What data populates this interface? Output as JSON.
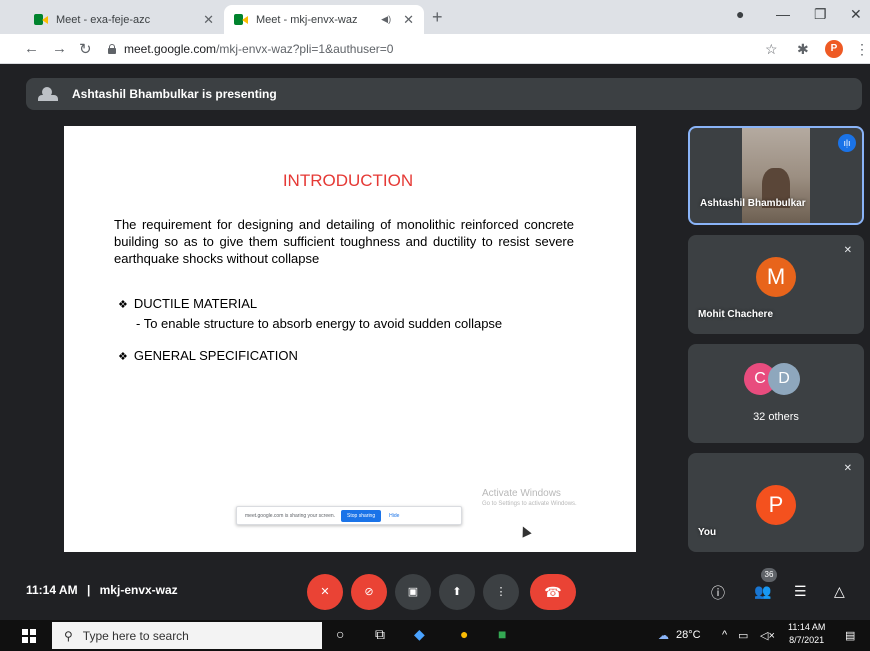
{
  "browser": {
    "tabs": [
      {
        "title": "Meet - exa-feje-azc",
        "active": false
      },
      {
        "title": "Meet - mkj-envx-waz",
        "active": true
      }
    ],
    "url_host": "meet.google.com",
    "url_rest": "/mkj-envx-waz?pli=1&authuser=0",
    "profile_initial": "P"
  },
  "meet": {
    "presenting_text": "Ashtashil Bhambulkar is presenting",
    "slide": {
      "title": "INTRODUCTION",
      "body": "The requirement for designing and detailing of monolithic reinforced concrete building so as to give them sufficient toughness and ductility to resist severe earthquake shocks without collapse",
      "bullet1": "DUCTILE MATERIAL",
      "bullet1_sub": "- To enable structure to absorb energy to avoid sudden collapse",
      "bullet2": "GENERAL SPECIFICATION",
      "share_notice": "meet.google.com is sharing your screen.",
      "stop_sharing": "Stop sharing",
      "hide": "Hide",
      "activate_title": "Activate Windows",
      "activate_sub": "Go to Settings to activate Windows."
    },
    "participants": [
      {
        "name": "Ashtashil Bhambulkar",
        "speaking": true
      },
      {
        "name": "Mohit Chachere",
        "initial": "M",
        "muted": true
      },
      {
        "initials": [
          "C",
          "D"
        ],
        "label": "32 others"
      },
      {
        "name": "You",
        "initial": "P",
        "muted": true
      }
    ],
    "time": "11:14 AM",
    "separator": "|",
    "meeting_code": "mkj-envx-waz",
    "people_count": "36"
  },
  "taskbar": {
    "search_placeholder": "Type here to search",
    "temperature": "28°C",
    "time": "11:14 AM",
    "date": "8/7/2021"
  },
  "colors": {
    "meet_bg": "#202124",
    "tile_bg": "#3c4043",
    "red": "#ea4335",
    "active_border": "#8ab4f8"
  }
}
